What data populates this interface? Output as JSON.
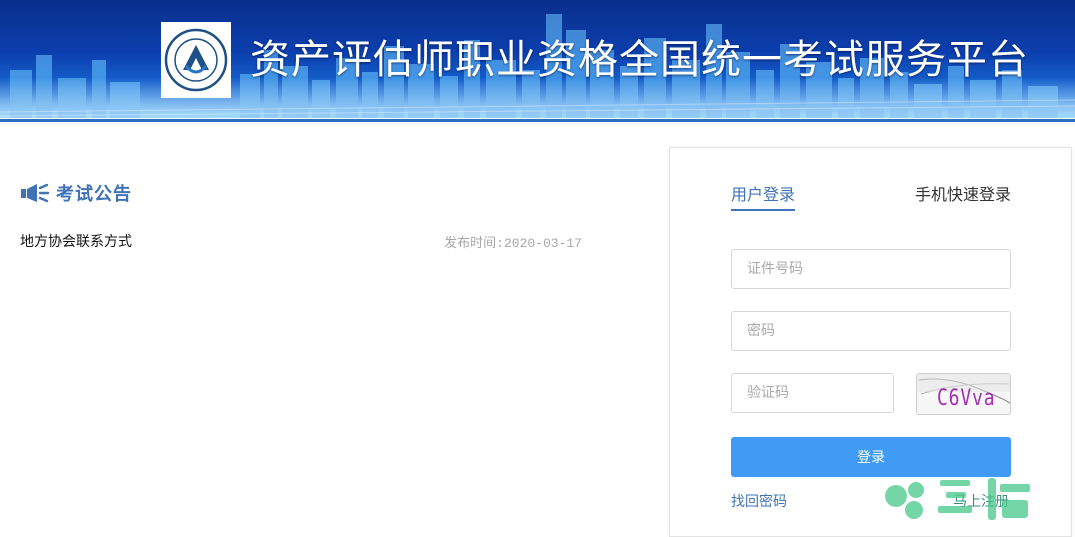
{
  "header": {
    "title": "资产评估师职业资格全国统一考试服务平台",
    "logo_icon": "china-appraisal-society-logo"
  },
  "announcements": {
    "heading": "考试公告",
    "heading_icon": "megaphone-icon",
    "items": [
      {
        "title": "地方协会联系方式",
        "date": "发布时间:2020-03-17"
      }
    ]
  },
  "login": {
    "tabs": [
      {
        "label": "用户登录",
        "active": true
      },
      {
        "label": "手机快速登录",
        "active": false
      }
    ],
    "id_placeholder": "证件号码",
    "password_placeholder": "密码",
    "captcha_placeholder": "验证码",
    "captcha_text": "C6Vva",
    "submit_label": "登录",
    "forgot_label": "找回密码",
    "register_label": "马上注册"
  },
  "colors": {
    "accent": "#3f73b6",
    "button": "#409bf5",
    "banner_top": "#0a2f8c",
    "banner_bottom": "#5fb6f4"
  }
}
